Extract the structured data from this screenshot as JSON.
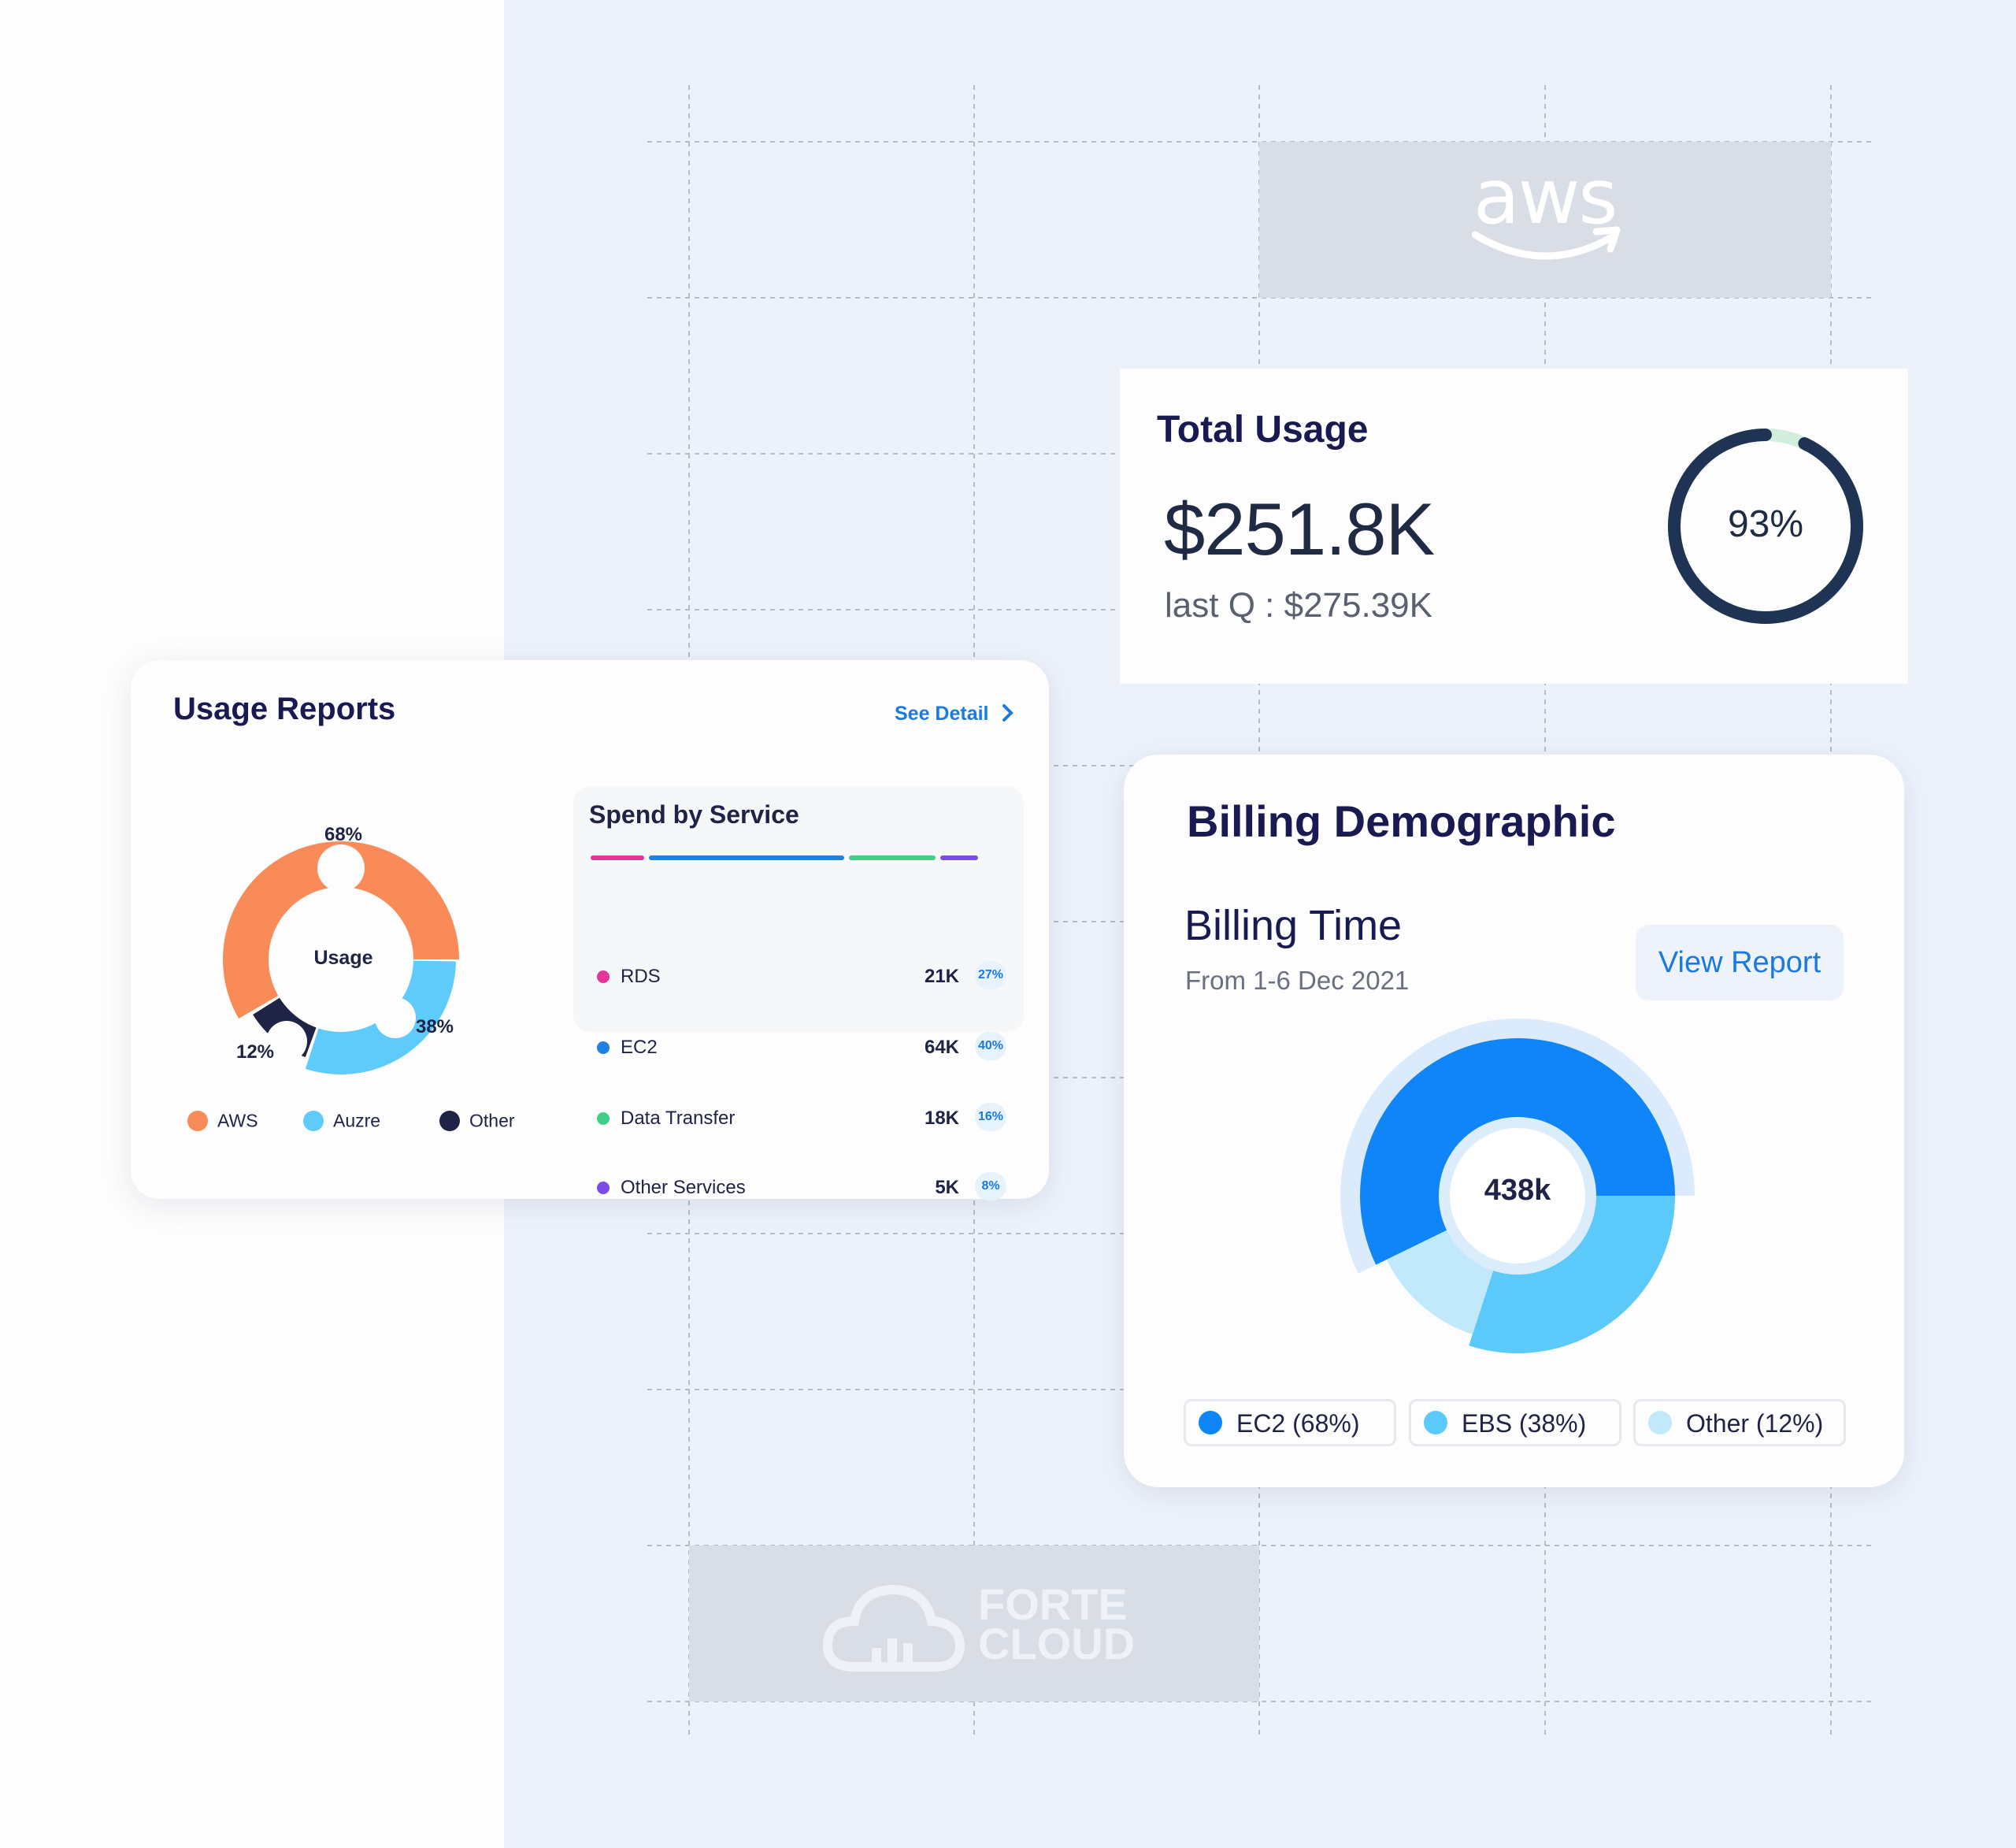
{
  "usage_reports": {
    "title": "Usage Reports",
    "see_detail": "See Detail",
    "donut_center": "Usage",
    "pct_aws": "68%",
    "pct_azure": "38%",
    "pct_other": "12%",
    "legend": [
      {
        "label": "AWS",
        "color": "#f98b59"
      },
      {
        "label": "Auzre",
        "color": "#5fcbfb"
      },
      {
        "label": "Other",
        "color": "#1f2346"
      }
    ]
  },
  "spend_by_service": {
    "title": "Spend by Service",
    "bar_colors": [
      "#e4359c",
      "#1f82e0",
      "#3fcf87",
      "#7a4de6"
    ],
    "rows": [
      {
        "name": "RDS",
        "value": "21K",
        "pct": "27%",
        "color": "#e4359c"
      },
      {
        "name": "EC2",
        "value": "64K",
        "pct": "40%",
        "color": "#1f82e0"
      },
      {
        "name": "Data Transfer",
        "value": "18K",
        "pct": "16%",
        "color": "#3fcf87"
      },
      {
        "name": "Other Services",
        "value": "5K",
        "pct": "8%",
        "color": "#7a4de6"
      }
    ]
  },
  "total_usage": {
    "title": "Total Usage",
    "amount": "$251.8K",
    "last_q": "last Q : $275.39K",
    "percent_label": "93%",
    "percent": 0.93
  },
  "billing": {
    "title": "Billing Demographic",
    "subtitle": "Billing Time",
    "date_range": "From 1-6 Dec 2021",
    "view_report": "View Report",
    "center": "438k",
    "legend": [
      {
        "label": "EC2 (68%)",
        "color": "#0f85f7"
      },
      {
        "label": "EBS (38%)",
        "color": "#5bc9fa"
      },
      {
        "label": "Other (12%)",
        "color": "#c2e9fb"
      }
    ]
  },
  "logos": {
    "aws": "aws",
    "forte_line1": "FORTE",
    "forte_line2": "CLOUD"
  }
}
